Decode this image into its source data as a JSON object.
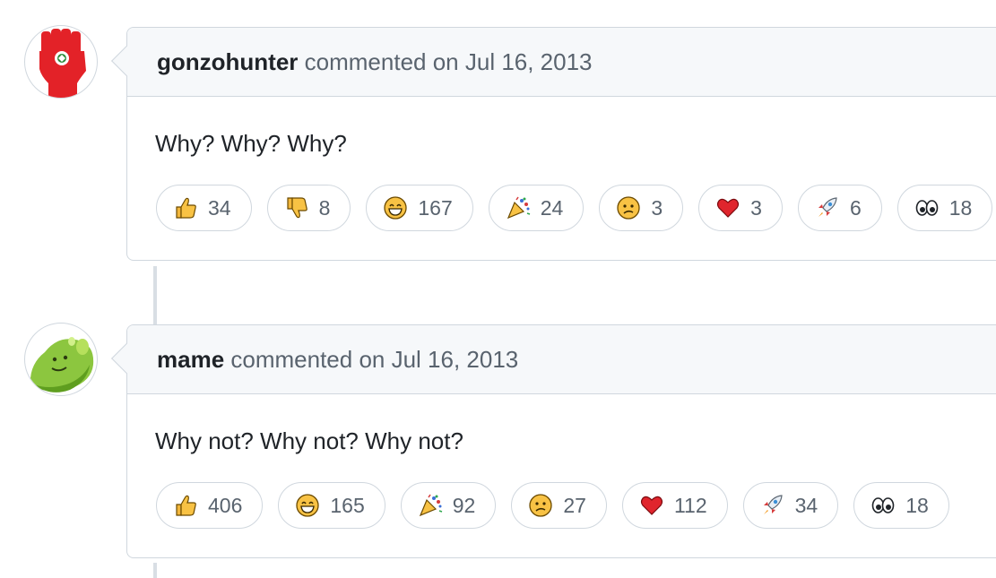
{
  "comments": [
    {
      "author": "gonzohunter",
      "action": " commented on Jul 16, 2013",
      "body": "Why? Why? Why?",
      "avatar_icon": "raised-fist-icon",
      "reactions": [
        {
          "icon": "thumbs-up-icon",
          "count": "34"
        },
        {
          "icon": "thumbs-down-icon",
          "count": "8"
        },
        {
          "icon": "laugh-icon",
          "count": "167"
        },
        {
          "icon": "hooray-icon",
          "count": "24"
        },
        {
          "icon": "confused-icon",
          "count": "3"
        },
        {
          "icon": "heart-icon",
          "count": "3"
        },
        {
          "icon": "rocket-icon",
          "count": "6"
        },
        {
          "icon": "eyes-icon",
          "count": "18"
        }
      ]
    },
    {
      "author": "mame",
      "action": " commented on Jul 16, 2013",
      "body": "Why not? Why not? Why not?",
      "avatar_icon": "green-blob-icon",
      "reactions": [
        {
          "icon": "thumbs-up-icon",
          "count": "406"
        },
        {
          "icon": "laugh-icon",
          "count": "165"
        },
        {
          "icon": "hooray-icon",
          "count": "92"
        },
        {
          "icon": "confused-icon",
          "count": "27"
        },
        {
          "icon": "heart-icon",
          "count": "112"
        },
        {
          "icon": "rocket-icon",
          "count": "34"
        },
        {
          "icon": "eyes-icon",
          "count": "18"
        }
      ]
    }
  ],
  "colors": {
    "border": "#d0d7de",
    "header_bg": "#f6f8fa",
    "muted_text": "#59636e",
    "text": "#1f2328"
  }
}
